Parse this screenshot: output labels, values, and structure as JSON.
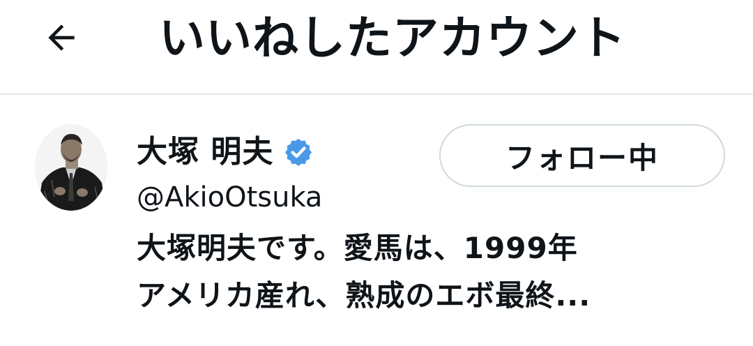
{
  "header": {
    "back_icon": "arrow-left-icon",
    "title": "いいねしたアカウント"
  },
  "account": {
    "avatar_icon": "user-avatar-photo",
    "display_name": "大塚 明夫",
    "verified_icon": "verified-badge-icon",
    "verified_color": "#4a99e9",
    "handle": "@AkioOtsuka",
    "follow_button_label": "フォロー中",
    "bio_lines": [
      "大塚明夫です。愛馬は、1999年",
      "アメリカ産れ、熟成のエボ最終..."
    ]
  },
  "colors": {
    "divider": "#e6e8ea",
    "button_border": "#cfd9de",
    "text": "#0f1419"
  }
}
